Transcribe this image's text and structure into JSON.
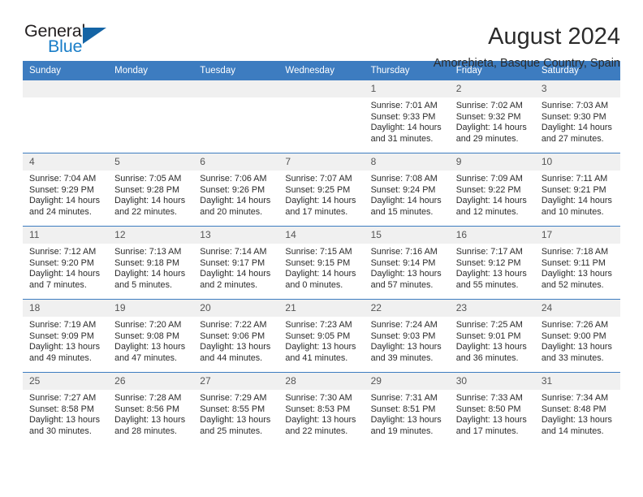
{
  "brand": {
    "name_top": "General",
    "name_bottom": "Blue",
    "triangle_color": "#1464a5",
    "blue_color": "#1a7ec8",
    "dark_color": "#231f20"
  },
  "header": {
    "title": "August 2024",
    "subtitle": "Amorebieta, Basque Country, Spain"
  },
  "theme": {
    "header_blue": "#3d7cc0",
    "daynum_bg": "#f0f0f0",
    "text": "#2b2b2b"
  },
  "weekdays": [
    "Sunday",
    "Monday",
    "Tuesday",
    "Wednesday",
    "Thursday",
    "Friday",
    "Saturday"
  ],
  "weeks": [
    [
      {
        "day": "",
        "empty": true,
        "lines": []
      },
      {
        "day": "",
        "empty": true,
        "lines": []
      },
      {
        "day": "",
        "empty": true,
        "lines": []
      },
      {
        "day": "",
        "empty": true,
        "lines": []
      },
      {
        "day": "1",
        "empty": false,
        "lines": [
          "Sunrise: 7:01 AM",
          "Sunset: 9:33 PM",
          "Daylight: 14 hours",
          "and 31 minutes."
        ]
      },
      {
        "day": "2",
        "empty": false,
        "lines": [
          "Sunrise: 7:02 AM",
          "Sunset: 9:32 PM",
          "Daylight: 14 hours",
          "and 29 minutes."
        ]
      },
      {
        "day": "3",
        "empty": false,
        "lines": [
          "Sunrise: 7:03 AM",
          "Sunset: 9:30 PM",
          "Daylight: 14 hours",
          "and 27 minutes."
        ]
      }
    ],
    [
      {
        "day": "4",
        "empty": false,
        "lines": [
          "Sunrise: 7:04 AM",
          "Sunset: 9:29 PM",
          "Daylight: 14 hours",
          "and 24 minutes."
        ]
      },
      {
        "day": "5",
        "empty": false,
        "lines": [
          "Sunrise: 7:05 AM",
          "Sunset: 9:28 PM",
          "Daylight: 14 hours",
          "and 22 minutes."
        ]
      },
      {
        "day": "6",
        "empty": false,
        "lines": [
          "Sunrise: 7:06 AM",
          "Sunset: 9:26 PM",
          "Daylight: 14 hours",
          "and 20 minutes."
        ]
      },
      {
        "day": "7",
        "empty": false,
        "lines": [
          "Sunrise: 7:07 AM",
          "Sunset: 9:25 PM",
          "Daylight: 14 hours",
          "and 17 minutes."
        ]
      },
      {
        "day": "8",
        "empty": false,
        "lines": [
          "Sunrise: 7:08 AM",
          "Sunset: 9:24 PM",
          "Daylight: 14 hours",
          "and 15 minutes."
        ]
      },
      {
        "day": "9",
        "empty": false,
        "lines": [
          "Sunrise: 7:09 AM",
          "Sunset: 9:22 PM",
          "Daylight: 14 hours",
          "and 12 minutes."
        ]
      },
      {
        "day": "10",
        "empty": false,
        "lines": [
          "Sunrise: 7:11 AM",
          "Sunset: 9:21 PM",
          "Daylight: 14 hours",
          "and 10 minutes."
        ]
      }
    ],
    [
      {
        "day": "11",
        "empty": false,
        "lines": [
          "Sunrise: 7:12 AM",
          "Sunset: 9:20 PM",
          "Daylight: 14 hours",
          "and 7 minutes."
        ]
      },
      {
        "day": "12",
        "empty": false,
        "lines": [
          "Sunrise: 7:13 AM",
          "Sunset: 9:18 PM",
          "Daylight: 14 hours",
          "and 5 minutes."
        ]
      },
      {
        "day": "13",
        "empty": false,
        "lines": [
          "Sunrise: 7:14 AM",
          "Sunset: 9:17 PM",
          "Daylight: 14 hours",
          "and 2 minutes."
        ]
      },
      {
        "day": "14",
        "empty": false,
        "lines": [
          "Sunrise: 7:15 AM",
          "Sunset: 9:15 PM",
          "Daylight: 14 hours",
          "and 0 minutes."
        ]
      },
      {
        "day": "15",
        "empty": false,
        "lines": [
          "Sunrise: 7:16 AM",
          "Sunset: 9:14 PM",
          "Daylight: 13 hours",
          "and 57 minutes."
        ]
      },
      {
        "day": "16",
        "empty": false,
        "lines": [
          "Sunrise: 7:17 AM",
          "Sunset: 9:12 PM",
          "Daylight: 13 hours",
          "and 55 minutes."
        ]
      },
      {
        "day": "17",
        "empty": false,
        "lines": [
          "Sunrise: 7:18 AM",
          "Sunset: 9:11 PM",
          "Daylight: 13 hours",
          "and 52 minutes."
        ]
      }
    ],
    [
      {
        "day": "18",
        "empty": false,
        "lines": [
          "Sunrise: 7:19 AM",
          "Sunset: 9:09 PM",
          "Daylight: 13 hours",
          "and 49 minutes."
        ]
      },
      {
        "day": "19",
        "empty": false,
        "lines": [
          "Sunrise: 7:20 AM",
          "Sunset: 9:08 PM",
          "Daylight: 13 hours",
          "and 47 minutes."
        ]
      },
      {
        "day": "20",
        "empty": false,
        "lines": [
          "Sunrise: 7:22 AM",
          "Sunset: 9:06 PM",
          "Daylight: 13 hours",
          "and 44 minutes."
        ]
      },
      {
        "day": "21",
        "empty": false,
        "lines": [
          "Sunrise: 7:23 AM",
          "Sunset: 9:05 PM",
          "Daylight: 13 hours",
          "and 41 minutes."
        ]
      },
      {
        "day": "22",
        "empty": false,
        "lines": [
          "Sunrise: 7:24 AM",
          "Sunset: 9:03 PM",
          "Daylight: 13 hours",
          "and 39 minutes."
        ]
      },
      {
        "day": "23",
        "empty": false,
        "lines": [
          "Sunrise: 7:25 AM",
          "Sunset: 9:01 PM",
          "Daylight: 13 hours",
          "and 36 minutes."
        ]
      },
      {
        "day": "24",
        "empty": false,
        "lines": [
          "Sunrise: 7:26 AM",
          "Sunset: 9:00 PM",
          "Daylight: 13 hours",
          "and 33 minutes."
        ]
      }
    ],
    [
      {
        "day": "25",
        "empty": false,
        "lines": [
          "Sunrise: 7:27 AM",
          "Sunset: 8:58 PM",
          "Daylight: 13 hours",
          "and 30 minutes."
        ]
      },
      {
        "day": "26",
        "empty": false,
        "lines": [
          "Sunrise: 7:28 AM",
          "Sunset: 8:56 PM",
          "Daylight: 13 hours",
          "and 28 minutes."
        ]
      },
      {
        "day": "27",
        "empty": false,
        "lines": [
          "Sunrise: 7:29 AM",
          "Sunset: 8:55 PM",
          "Daylight: 13 hours",
          "and 25 minutes."
        ]
      },
      {
        "day": "28",
        "empty": false,
        "lines": [
          "Sunrise: 7:30 AM",
          "Sunset: 8:53 PM",
          "Daylight: 13 hours",
          "and 22 minutes."
        ]
      },
      {
        "day": "29",
        "empty": false,
        "lines": [
          "Sunrise: 7:31 AM",
          "Sunset: 8:51 PM",
          "Daylight: 13 hours",
          "and 19 minutes."
        ]
      },
      {
        "day": "30",
        "empty": false,
        "lines": [
          "Sunrise: 7:33 AM",
          "Sunset: 8:50 PM",
          "Daylight: 13 hours",
          "and 17 minutes."
        ]
      },
      {
        "day": "31",
        "empty": false,
        "lines": [
          "Sunrise: 7:34 AM",
          "Sunset: 8:48 PM",
          "Daylight: 13 hours",
          "and 14 minutes."
        ]
      }
    ]
  ]
}
